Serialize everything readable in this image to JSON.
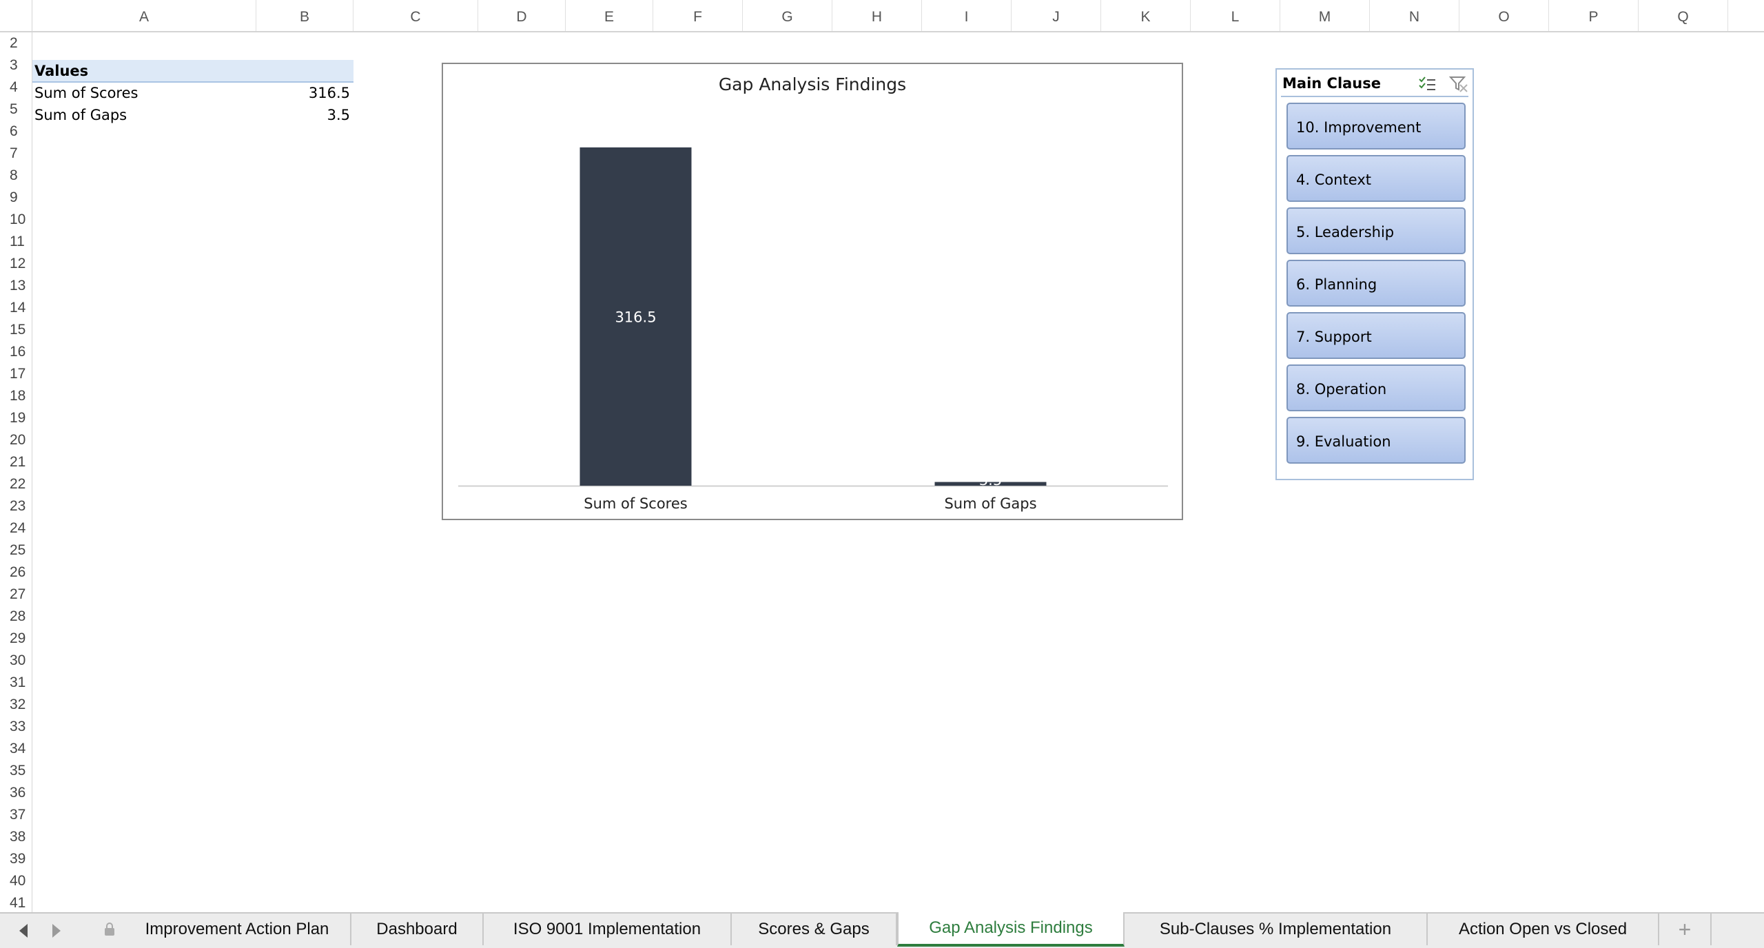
{
  "columns": [
    "A",
    "B",
    "C",
    "D",
    "E",
    "F",
    "G",
    "H",
    "I",
    "J",
    "K",
    "L",
    "M",
    "N",
    "O",
    "P",
    "Q"
  ],
  "rows": [
    "2",
    "3",
    "4",
    "5",
    "6",
    "7",
    "8",
    "9",
    "10",
    "11",
    "12",
    "13",
    "14",
    "15",
    "16",
    "17",
    "18",
    "19",
    "20",
    "21",
    "22",
    "23",
    "24",
    "25",
    "26",
    "27",
    "28",
    "29",
    "30",
    "31",
    "32",
    "33",
    "34",
    "35",
    "36",
    "37",
    "38",
    "39",
    "40",
    "41"
  ],
  "pivot": {
    "header": "Values",
    "rows": [
      {
        "label": "Sum of Scores",
        "value": "316.5"
      },
      {
        "label": "Sum of Gaps",
        "value": "3.5"
      }
    ]
  },
  "chart_data": {
    "type": "bar",
    "title": "Gap Analysis Findings",
    "categories": [
      "Sum of Scores",
      "Sum of Gaps"
    ],
    "values": [
      316.5,
      3.5
    ],
    "data_labels": [
      "316.5",
      "3.5"
    ],
    "bar_color": "#343d4b",
    "ylim": [
      0,
      330
    ],
    "grid": false,
    "legend": "none"
  },
  "slicer": {
    "title": "Main Clause",
    "icons": [
      "multi-select-icon",
      "clear-filter-icon"
    ],
    "items": [
      "10. Improvement",
      "4. Context",
      "5. Leadership",
      "6. Planning",
      "7. Support",
      "8. Operation",
      "9. Evaluation"
    ]
  },
  "tabs": {
    "items": [
      "Improvement Action Plan",
      "Dashboard",
      "ISO 9001 Implementation",
      "Scores & Gaps",
      "Gap Analysis Findings",
      "Sub-Clauses % Implementation",
      "Action Open vs Closed"
    ],
    "active": "Gap Analysis Findings",
    "add_label": "+",
    "active_color": "#2e7d3e"
  }
}
